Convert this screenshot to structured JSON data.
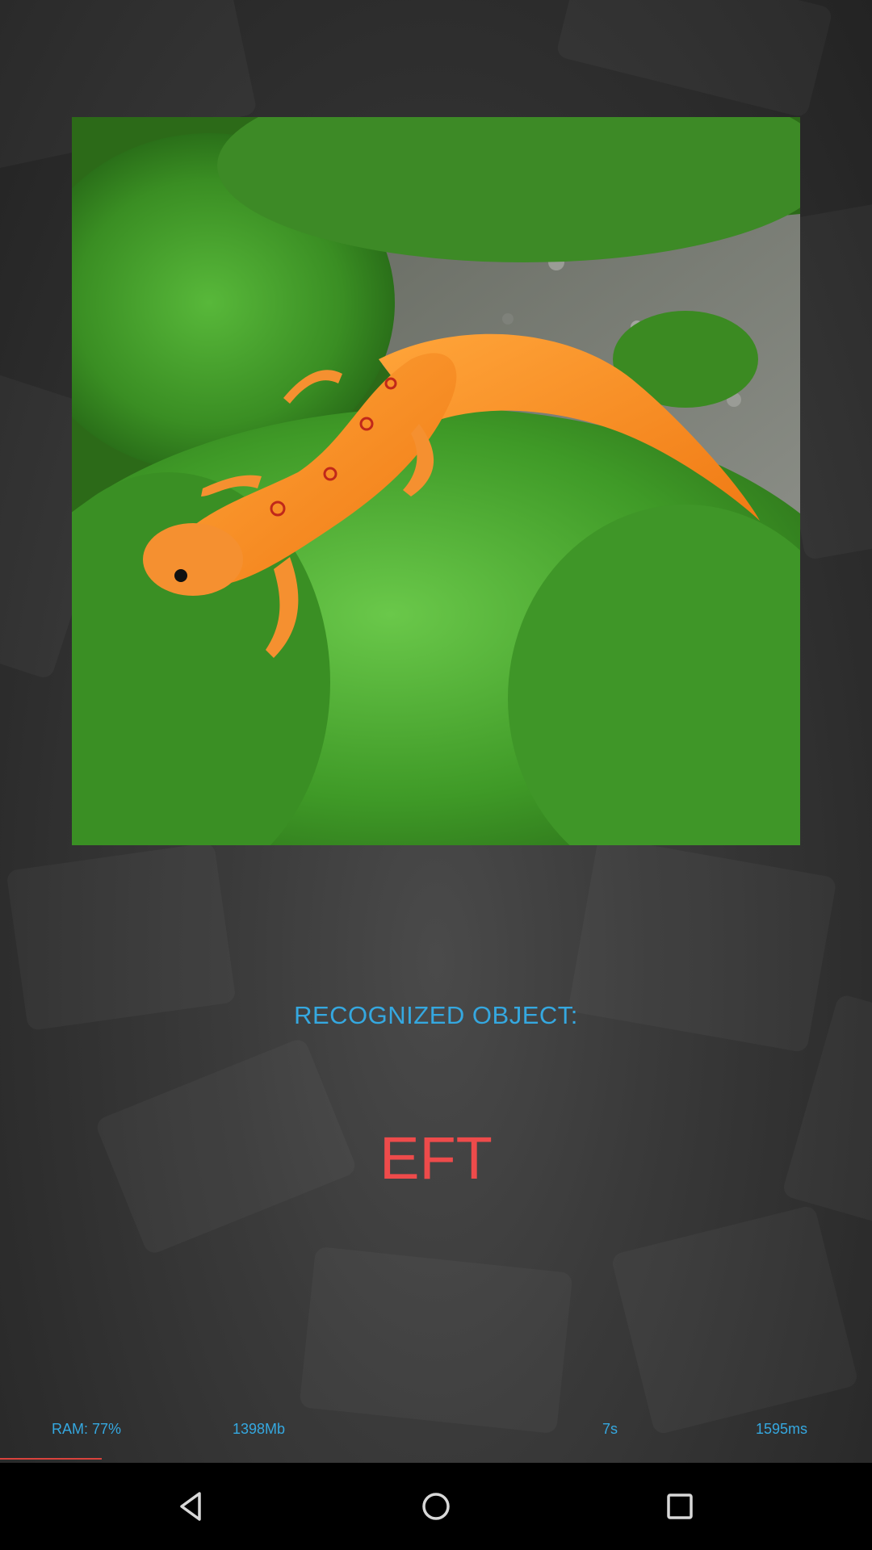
{
  "result": {
    "heading": "RECOGNIZED OBJECT:",
    "label": "EFT"
  },
  "stats": {
    "ram": "RAM: 77%",
    "memory": "1398Mb",
    "elapsed": "7s",
    "inference": "1595ms"
  },
  "colors": {
    "accent_blue": "#35a8e0",
    "result_red": "#ee4b4b",
    "progress_red": "#d9423c"
  },
  "navbar": {
    "icons": [
      "back-icon",
      "home-icon",
      "recents-icon"
    ]
  }
}
